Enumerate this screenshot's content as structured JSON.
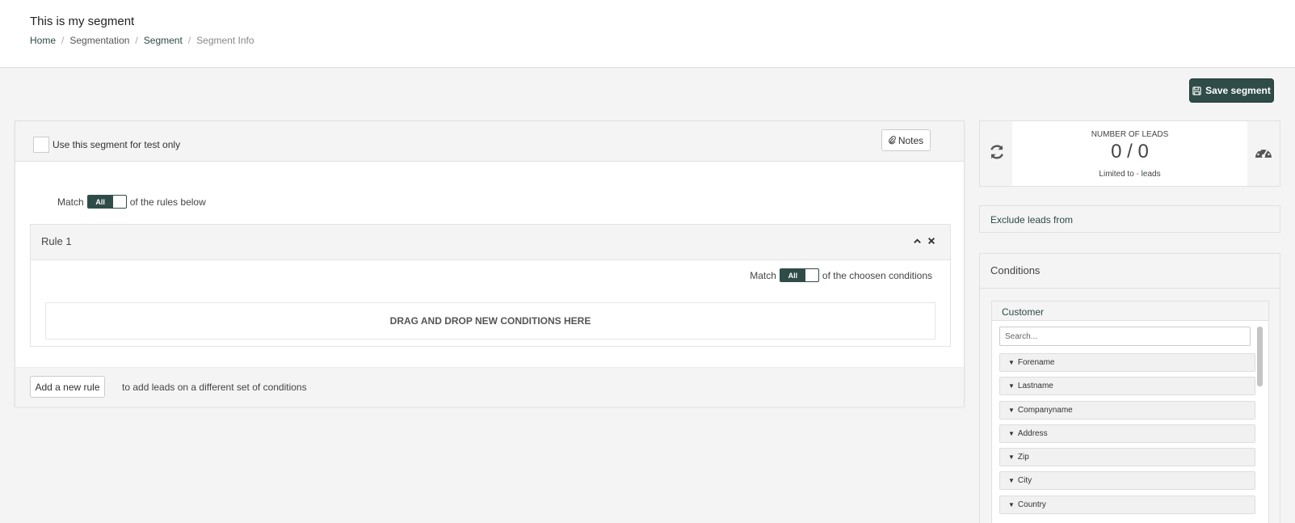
{
  "header": {
    "title": "This is my segment",
    "breadcrumb": [
      {
        "label": "Home"
      },
      {
        "label": "Segmentation"
      },
      {
        "label": "Segment"
      },
      {
        "label": "Segment Info"
      }
    ]
  },
  "toolbar": {
    "save_label": "Save segment"
  },
  "segment": {
    "test_only_label": "Use this segment for test only",
    "notes_label": "Notes",
    "match_prefix": "Match",
    "match_value": "All",
    "match_suffix": "of the rules below",
    "rules": [
      {
        "title": "Rule 1",
        "match_prefix": "Match",
        "match_value": "All",
        "match_suffix": "of the choosen conditions",
        "dropzone": "DRAG AND DROP NEW CONDITIONS HERE"
      }
    ],
    "add_rule_label": "Add a new rule",
    "add_rule_text": "to add leads on a different set of conditions"
  },
  "leads": {
    "label": "NUMBER OF LEADS",
    "count": "0 / 0",
    "limit_prefix": "Limited to",
    "limit_value": "-",
    "limit_suffix": "leads"
  },
  "exclude": {
    "label": "Exclude leads from"
  },
  "conditions": {
    "title": "Conditions",
    "groups": [
      {
        "title": "Customer",
        "search_placeholder": "Search...",
        "fields": [
          "Forename",
          "Lastname",
          "Companyname",
          "Address",
          "Zip",
          "City",
          "Country"
        ]
      }
    ]
  },
  "colors": {
    "accent": "#2f4c48",
    "link": "#2d4a45",
    "background": "#f4f4f4"
  },
  "icons": {
    "save": "floppy-icon",
    "notes": "paperclip-icon",
    "refresh": "refresh-icon",
    "gauge": "dashboard-gauge-icon",
    "collapse": "chevron-up-icon",
    "remove": "close-icon",
    "field": "tag-icon"
  }
}
